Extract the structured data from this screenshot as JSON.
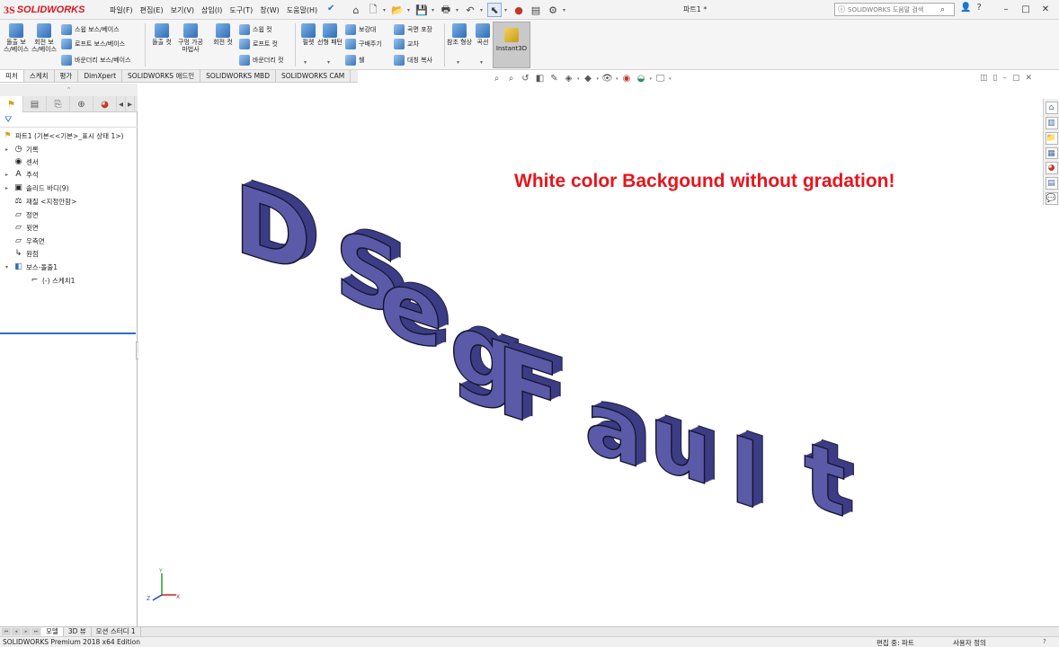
{
  "app": {
    "logo_ds": "3S",
    "logo_name": "SOLIDWORKS",
    "document_title": "파트1 *",
    "menu": [
      "파일(F)",
      "편집(E)",
      "보기(V)",
      "삽입(I)",
      "도구(T)",
      "창(W)",
      "도움말(H)"
    ],
    "search_placeholder": "SOLIDWORKS 도움말 검색",
    "win_controls": [
      "–",
      "□",
      "✕"
    ]
  },
  "commands": {
    "boss_extrude": "돌출 보스/베이스",
    "revolve_boss": "회전 보스/베이스",
    "sweep_boss": "스윕 보스/베이스",
    "loft_boss": "로프트 보스/베이스",
    "boundary_boss": "바운더리 보스/베이스",
    "cut_extrude": "돌출 컷",
    "hole_wizard": "구멍 가공 마법사",
    "revolve_cut": "회전 컷",
    "sweep_cut": "스윕 컷",
    "loft_cut": "로프트 컷",
    "boundary_cut": "바운더리 컷",
    "fillet": "필렛",
    "linear_pattern": "선형 패턴",
    "rib": "보강대",
    "draft": "구배주기",
    "shell": "쉘",
    "wrap": "곡면 포장",
    "intersect": "교차",
    "mirror": "대칭 복사",
    "ref_geometry": "참조 형상",
    "curves": "곡선",
    "instant3d": "Instant3D"
  },
  "cm_tabs": [
    "피처",
    "스케치",
    "평가",
    "DimXpert",
    "SOLIDWORKS 애드인",
    "SOLIDWORKS MBD",
    "SOLIDWORKS CAM"
  ],
  "tree": {
    "root": "파트1  (기본<<기본>_표시 상태 1>)",
    "items": [
      "기록",
      "센서",
      "주석",
      "솔리드 바디(9)",
      "재질 <지정안함>",
      "정면",
      "윗면",
      "우측면",
      "원점",
      "보스-돌출1",
      "(-) 스케치1"
    ]
  },
  "graphics": {
    "annotation": "White color Backgound without  gradation!",
    "model_text": "DSegFault",
    "model_color": "#5a5aa8",
    "background": "#ffffff"
  },
  "triad": {
    "x": "X",
    "y": "Y",
    "z": "Z"
  },
  "bottom_tabs": [
    "모델",
    "3D 뷰",
    "모션 스터디 1"
  ],
  "status": {
    "edition": "SOLIDWORKS Premium 2018 x64 Edition",
    "editing": "편집 중: 파트",
    "units": "사용자 정의",
    "help": "?"
  }
}
